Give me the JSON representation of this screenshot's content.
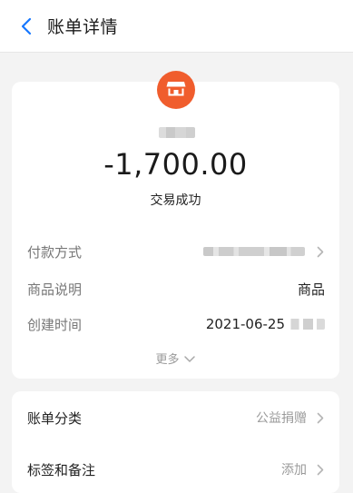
{
  "header": {
    "title": "账单详情"
  },
  "summary": {
    "amount": "-1,700.00",
    "status": "交易成功"
  },
  "details": {
    "rows": [
      {
        "label": "付款方式",
        "value": ""
      },
      {
        "label": "商品说明",
        "value": "商品"
      },
      {
        "label": "创建时间",
        "value": "2021-06-25"
      }
    ],
    "more_label": "更多"
  },
  "actions": {
    "rows": [
      {
        "label": "账单分类",
        "value": "公益捐赠"
      },
      {
        "label": "标签和备注",
        "value": "添加"
      }
    ]
  },
  "icons": {
    "back": "chevron-left-icon",
    "merchant": "storefront-icon",
    "more": "chevron-down-icon",
    "row_arrow": "chevron-right-icon"
  },
  "colors": {
    "accent": "#1677ff",
    "merchant_badge": "#f05d2d",
    "background": "#f3f3f3",
    "card": "#ffffff",
    "muted_text": "#9a9a9a"
  }
}
